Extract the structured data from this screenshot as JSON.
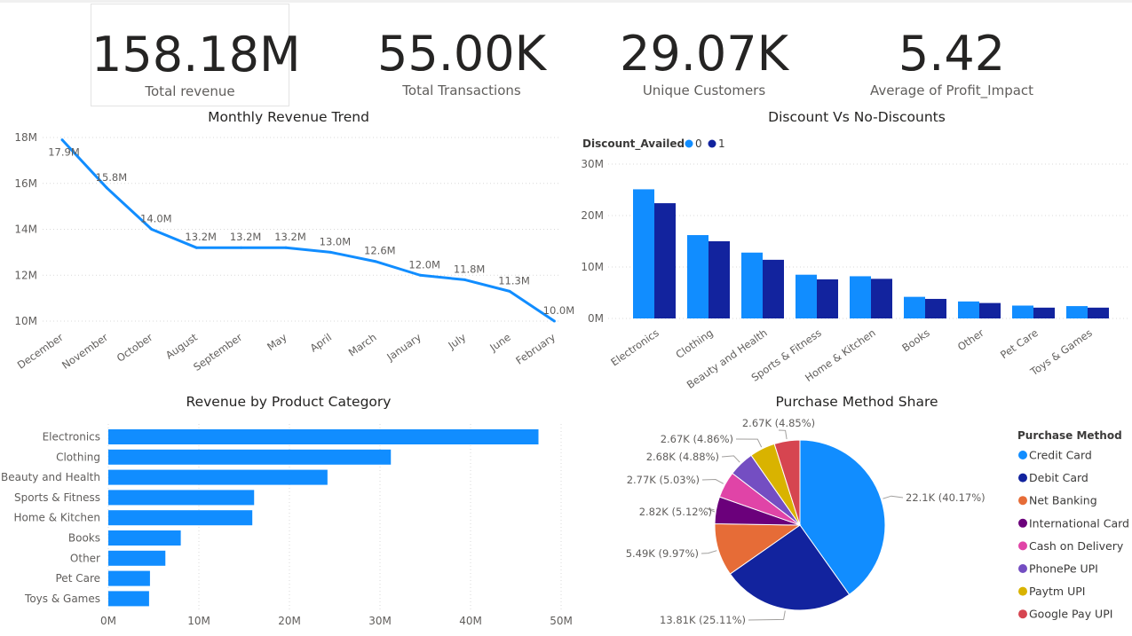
{
  "kpis": [
    {
      "value": "158.18M",
      "label": "Total revenue"
    },
    {
      "value": "55.00K",
      "label": "Total Transactions"
    },
    {
      "value": "29.07K",
      "label": "Unique Customers"
    },
    {
      "value": "5.42",
      "label": "Average of Profit_Impact"
    }
  ],
  "colors": {
    "blue": "#118DFF",
    "navy": "#12239E",
    "grid": "#d9d9d9",
    "axis_text": "#605e5c"
  },
  "chart_data": [
    {
      "type": "line",
      "title": "Monthly Revenue Trend",
      "x": [
        "December",
        "November",
        "October",
        "August",
        "September",
        "May",
        "April",
        "March",
        "January",
        "July",
        "June",
        "February"
      ],
      "values": [
        17.9,
        15.8,
        14.0,
        13.2,
        13.2,
        13.2,
        13.0,
        12.6,
        12.0,
        11.8,
        11.3,
        10.0
      ],
      "data_labels": [
        "17.9M",
        "15.8M",
        "14.0M",
        "13.2M",
        "13.2M",
        "13.2M",
        "13.0M",
        "12.6M",
        "12.0M",
        "11.8M",
        "11.3M",
        "10.0M"
      ],
      "y_ticks": [
        {
          "v": 10,
          "label": "10M"
        },
        {
          "v": 12,
          "label": "12M"
        },
        {
          "v": 14,
          "label": "14M"
        },
        {
          "v": 16,
          "label": "16M"
        },
        {
          "v": 18,
          "label": "18M"
        }
      ],
      "ylim": [
        10,
        18
      ],
      "unit": "M",
      "grid": true
    },
    {
      "type": "bar",
      "title": "Discount Vs No-Discounts",
      "legend_title": "Discount_Availed",
      "legend_position": "top-left",
      "categories": [
        "Electronics",
        "Clothing",
        "Beauty and Health",
        "Sports & Fitness",
        "Home & Kitchen",
        "Books",
        "Other",
        "Pet Care",
        "Toys & Games"
      ],
      "series": [
        {
          "name": "0",
          "color": "#118DFF",
          "values": [
            25.1,
            16.2,
            12.8,
            8.5,
            8.2,
            4.2,
            3.3,
            2.5,
            2.4
          ]
        },
        {
          "name": "1",
          "color": "#12239E",
          "values": [
            22.4,
            15.0,
            11.4,
            7.6,
            7.7,
            3.8,
            3.0,
            2.1,
            2.1
          ]
        }
      ],
      "y_ticks": [
        {
          "v": 0,
          "label": "0M"
        },
        {
          "v": 10,
          "label": "10M"
        },
        {
          "v": 20,
          "label": "20M"
        },
        {
          "v": 30,
          "label": "30M"
        }
      ],
      "ylim": [
        0,
        30
      ],
      "unit": "M",
      "grid": true
    },
    {
      "type": "bar",
      "orientation": "horizontal",
      "title": "Revenue by Product Category",
      "categories": [
        "Electronics",
        "Clothing",
        "Beauty and Health",
        "Sports & Fitness",
        "Home & Kitchen",
        "Books",
        "Other",
        "Pet Care",
        "Toys & Games"
      ],
      "values": [
        47.5,
        31.2,
        24.2,
        16.1,
        15.9,
        8.0,
        6.3,
        4.6,
        4.5
      ],
      "x_ticks": [
        {
          "v": 0,
          "label": "0M"
        },
        {
          "v": 10,
          "label": "10M"
        },
        {
          "v": 20,
          "label": "20M"
        },
        {
          "v": 30,
          "label": "30M"
        },
        {
          "v": 40,
          "label": "40M"
        },
        {
          "v": 50,
          "label": "50M"
        }
      ],
      "xlim": [
        0,
        50
      ],
      "unit": "M",
      "color": "#118DFF",
      "grid": true
    },
    {
      "type": "pie",
      "title": "Purchase Method Share",
      "legend_title": "Purchase Method",
      "legend_position": "right",
      "slices": [
        {
          "name": "Credit Card",
          "value": 22100,
          "label": "22.1K (40.17%)",
          "color": "#118DFF"
        },
        {
          "name": "Debit Card",
          "value": 13810,
          "label": "13.81K (25.11%)",
          "color": "#12239E"
        },
        {
          "name": "Net Banking",
          "value": 5490,
          "label": "5.49K (9.97%)",
          "color": "#E66C37"
        },
        {
          "name": "International Card",
          "value": 2820,
          "label": "2.82K (5.12%)",
          "color": "#6B007B"
        },
        {
          "name": "Cash on Delivery",
          "value": 2770,
          "label": "2.77K (5.03%)",
          "color": "#E044A7"
        },
        {
          "name": "PhonePe UPI",
          "value": 2680,
          "label": "2.68K (4.88%)",
          "color": "#744EC2"
        },
        {
          "name": "Paytm UPI",
          "value": 2670,
          "label": "2.67K (4.86%)",
          "color": "#D9B300"
        },
        {
          "name": "Google Pay UPI",
          "value": 2670,
          "label": "2.67K (4.85%)",
          "color": "#D64550"
        }
      ]
    }
  ]
}
